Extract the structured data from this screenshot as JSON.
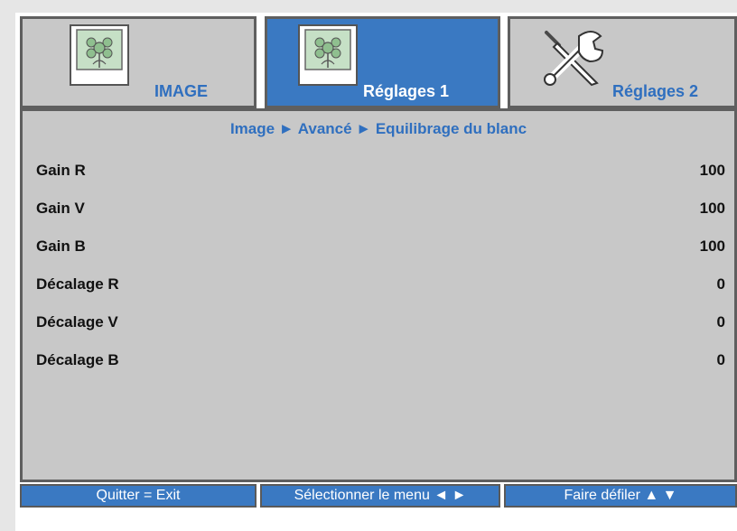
{
  "tabs": [
    {
      "label": "IMAGE",
      "icon": "image-photo-icon",
      "active": false
    },
    {
      "label": "Réglages 1",
      "icon": "settings-photo-icon",
      "active": true
    },
    {
      "label": "Réglages 2",
      "icon": "tools-icon",
      "active": false
    }
  ],
  "breadcrumb": "Image ► Avancé ► Equilibrage du blanc",
  "rows": [
    {
      "label": "Gain R",
      "value": "100"
    },
    {
      "label": "Gain V",
      "value": "100"
    },
    {
      "label": "Gain B",
      "value": "100"
    },
    {
      "label": "Décalage R",
      "value": "0"
    },
    {
      "label": "Décalage V",
      "value": "0"
    },
    {
      "label": "Décalage B",
      "value": "0"
    }
  ],
  "footer": {
    "exit": "Quitter = Exit",
    "select": "Sélectionner le menu ◄ ►",
    "scroll": "Faire défiler ▲ ▼"
  },
  "colors": {
    "accent_blue": "#3a79c2",
    "panel_gray": "#c8c8c8",
    "border_gray": "#5f5f5f",
    "breadcrumb_blue": "#2f6fbf"
  }
}
